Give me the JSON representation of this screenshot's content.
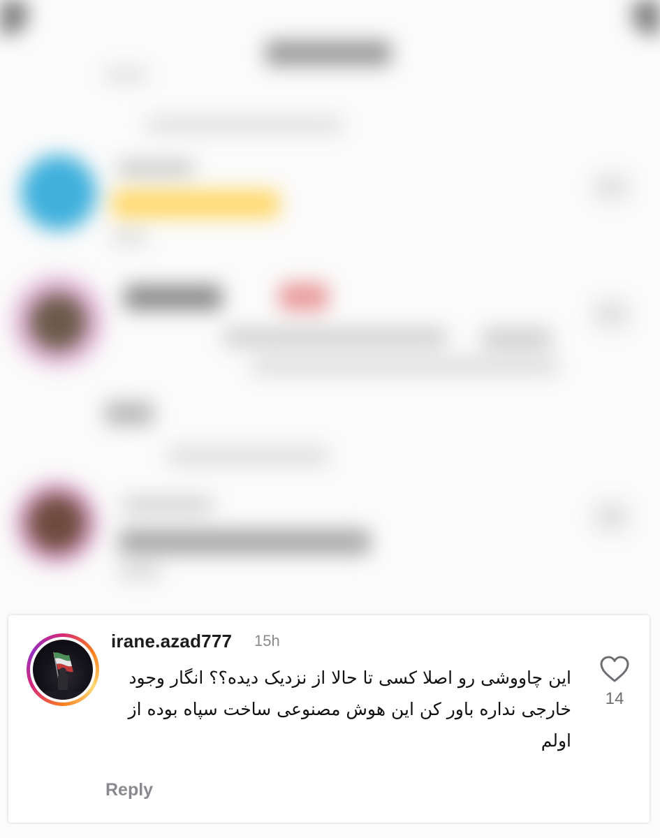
{
  "comment": {
    "username": "irane.azad777",
    "timestamp": "15h",
    "text": "این چاووشی رو اصلا کسی تا حالا از نزدیک دیده؟؟ انگار وجود خارجی نداره باور کن این هوش مصنوعی ساخت سپاه بوده از اولم",
    "like_count": "14",
    "reply_label": "Reply",
    "avatar_icon": "flag-avatar-icon",
    "like_icon": "heart-outline-icon"
  },
  "colors": {
    "username": "#1c1c1e",
    "secondary_text": "#8a8a8e",
    "story_ring": [
      "#d62976",
      "#fa7e1e",
      "#feda75",
      "#962fbf"
    ]
  }
}
